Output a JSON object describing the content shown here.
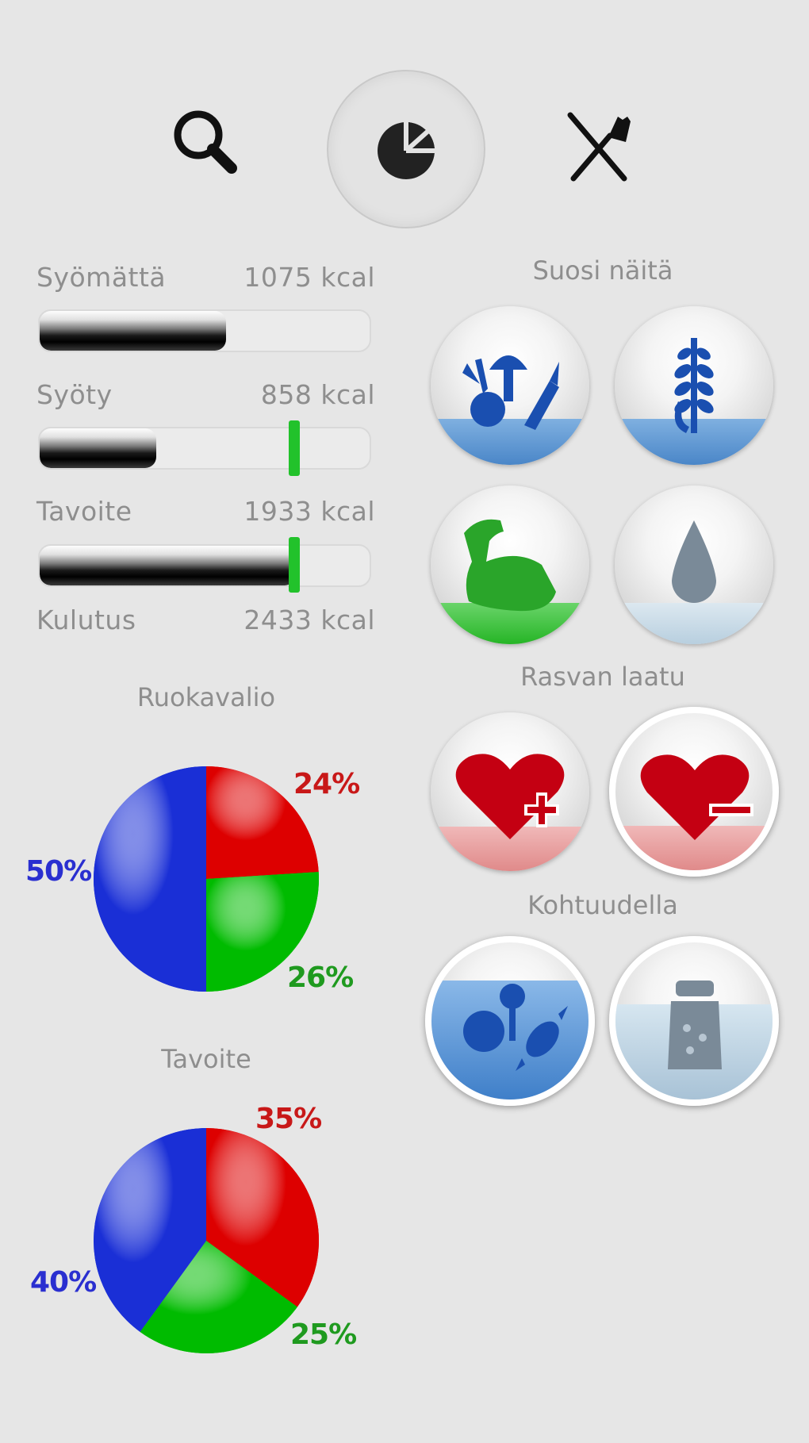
{
  "toolbar": {
    "items": [
      {
        "icon": "search-icon",
        "active": false
      },
      {
        "icon": "nutrition-chart-icon",
        "active": true
      },
      {
        "icon": "fork-knife-icon",
        "active": false
      }
    ]
  },
  "energy": {
    "rows": [
      {
        "label": "Syömättä",
        "value": "1075 kcal"
      },
      {
        "label": "Syöty",
        "value": "858 kcal"
      },
      {
        "label": "Tavoite",
        "value": "1933 kcal"
      },
      {
        "label": "Kulutus",
        "value": "2433 kcal"
      }
    ],
    "bars": [
      {
        "name": "uneaten-bar",
        "fill": 0.56,
        "marker": null
      },
      {
        "name": "eaten-bar",
        "fill": 0.35,
        "marker": 0.77
      },
      {
        "name": "goal-bar",
        "fill": 0.77,
        "marker": 0.77
      }
    ],
    "marker_color": "#22c22b"
  },
  "diet": {
    "title": "Ruokavalio",
    "chart_data": {
      "type": "pie",
      "labels": [
        "24%",
        "26%",
        "50%"
      ],
      "values": [
        24,
        26,
        50
      ],
      "colors": [
        "#dd0000",
        "#00bb00",
        "#1a2fd6"
      ]
    }
  },
  "goal": {
    "title": "Tavoite",
    "chart_data": {
      "type": "pie",
      "labels": [
        "35%",
        "25%",
        "40%"
      ],
      "values": [
        35,
        25,
        40
      ],
      "colors": [
        "#dd0000",
        "#00bb00",
        "#1a2fd6"
      ]
    }
  },
  "favor": {
    "title": "Suosi näitä",
    "items": [
      {
        "icon": "vegetables-icon",
        "color": "#1a5bb5"
      },
      {
        "icon": "grain-icon",
        "color": "#1a5bb5"
      },
      {
        "icon": "protein-muscle-icon",
        "color": "#2eb52e"
      },
      {
        "icon": "water-drop-icon",
        "color": "#7a8a98"
      }
    ]
  },
  "fat_quality": {
    "title": "Rasvan laatu",
    "items": [
      {
        "icon": "heart-plus-icon",
        "color": "#c00010"
      },
      {
        "icon": "heart-minus-icon",
        "color": "#c00010",
        "selected": true
      }
    ]
  },
  "moderation": {
    "title": "Kohtuudella",
    "items": [
      {
        "icon": "sweets-icon",
        "color": "#1a5bb5",
        "selected": true
      },
      {
        "icon": "salt-shaker-icon",
        "color": "#7a8a98",
        "selected": true
      }
    ]
  }
}
